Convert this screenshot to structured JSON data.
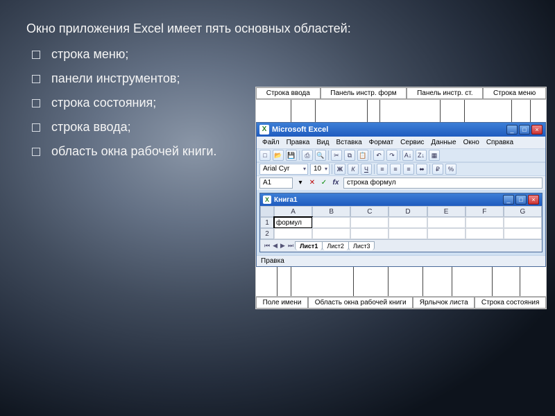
{
  "slide": {
    "title": "Окно приложения Excel имеет пять основных областей:",
    "bullets": [
      "строка меню;",
      "панели инструментов;",
      "строка состояния;",
      "строка ввода;",
      "область окна рабочей книги."
    ]
  },
  "callouts": {
    "top": [
      "Строка ввода",
      "Панель инстр. форм",
      "Панель инстр. ст.",
      "Строка меню"
    ],
    "bottom": [
      "Поле имени",
      "Область окна рабочей книги",
      "Ярлычок листа",
      "Строка состояния"
    ]
  },
  "excel": {
    "app_title": "Microsoft Excel",
    "menus": [
      "Файл",
      "Правка",
      "Вид",
      "Вставка",
      "Формат",
      "Сервис",
      "Данные",
      "Окно",
      "Справка"
    ],
    "font_name": "Arial Cyr",
    "font_size": "10",
    "active_cell": "A1",
    "formula_text": "строка формул",
    "workbook_title": "Книга1",
    "columns": [
      "A",
      "B",
      "C",
      "D",
      "E",
      "F",
      "G"
    ],
    "rows": [
      "1",
      "2"
    ],
    "cell_A1": "формул",
    "sheets": [
      "Лист1",
      "Лист2",
      "Лист3"
    ],
    "status_text": "Правка"
  }
}
